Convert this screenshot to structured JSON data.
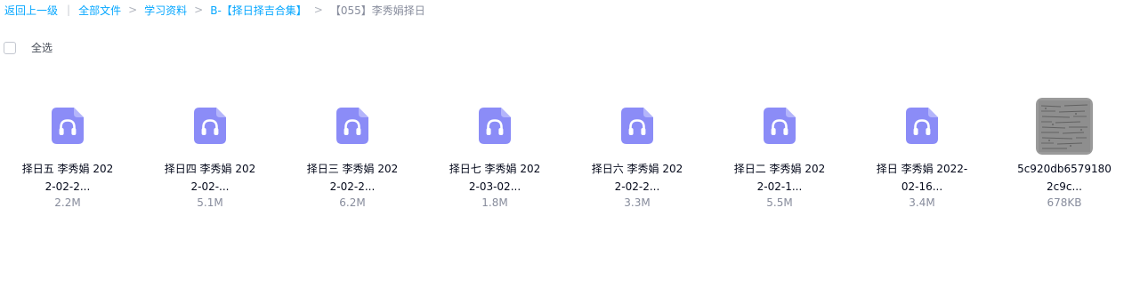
{
  "breadcrumb": {
    "back": "返回上一级",
    "all_files": "全部文件",
    "path": [
      "学习资料",
      "B-【择日择吉合集】"
    ],
    "current": "【055】李秀娟择日",
    "separator": ">"
  },
  "select_all": {
    "label": "全选"
  },
  "colors": {
    "link": "#06a7ff",
    "audio_icon_bg": "#8b8cf7",
    "audio_icon_fold": "#b4b5fb"
  },
  "files": [
    {
      "icon": "audio-file-icon",
      "name_line1": "择日五 李秀娟 202",
      "name_line2": "2-02-2...",
      "size": "2.2M"
    },
    {
      "icon": "audio-file-icon",
      "name_line1": "择日四 李秀娟 202",
      "name_line2": "2-02-...",
      "size": "5.1M"
    },
    {
      "icon": "audio-file-icon",
      "name_line1": "择日三 李秀娟 202",
      "name_line2": "2-02-2...",
      "size": "6.2M"
    },
    {
      "icon": "audio-file-icon",
      "name_line1": "择日七 李秀娟 202",
      "name_line2": "2-03-02...",
      "size": "1.8M"
    },
    {
      "icon": "audio-file-icon",
      "name_line1": "择日六 李秀娟 202",
      "name_line2": "2-02-2...",
      "size": "3.3M"
    },
    {
      "icon": "audio-file-icon",
      "name_line1": "择日二 李秀娟 202",
      "name_line2": "2-02-1...",
      "size": "5.5M"
    },
    {
      "icon": "audio-file-icon",
      "name_line1": "择日 李秀娟 2022-",
      "name_line2": "02-16...",
      "size": "3.4M"
    },
    {
      "icon": "image-thumbnail",
      "name_line1": "5c920db6579180",
      "name_line2": "2c9c...",
      "size": "678KB"
    }
  ]
}
